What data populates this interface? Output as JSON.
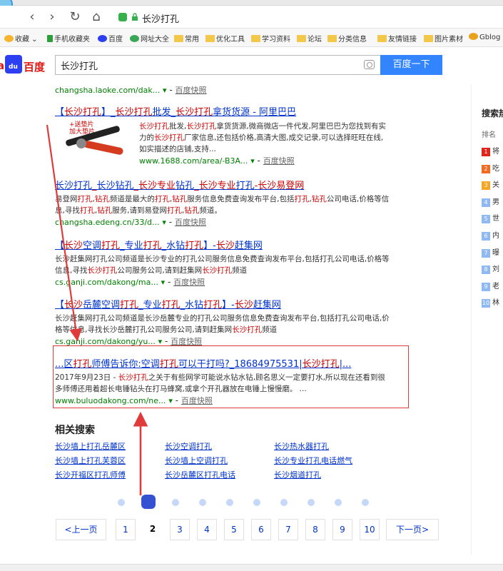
{
  "browser": {
    "address_text": "长沙打孔",
    "back_glyph": "‹",
    "forward_glyph": "›",
    "refresh_glyph": "↻",
    "home_glyph": "⌂"
  },
  "bookmarks": [
    {
      "label": "收藏",
      "icon": "star-icon"
    },
    {
      "label": "手机收藏夹",
      "icon": "phone-icon"
    },
    {
      "label": "百度",
      "icon": "baidu-paw-icon"
    },
    {
      "label": "网址大全",
      "icon": "globe-icon"
    },
    {
      "label": "常用",
      "icon": "folder-icon"
    },
    {
      "label": "优化工具",
      "icon": "folder-icon"
    },
    {
      "label": "学习资料",
      "icon": "folder-icon"
    },
    {
      "label": "论坛",
      "icon": "folder-icon"
    },
    {
      "label": "分类信息",
      "icon": "folder-icon"
    },
    {
      "label": "友情链接",
      "icon": "folder-icon"
    },
    {
      "label": "图片素材",
      "icon": "folder-icon"
    },
    {
      "label": "Gblog",
      "icon": "gblog-icon"
    }
  ],
  "search": {
    "logo_left": "ai",
    "logo_paw": "du",
    "logo_right": "百度",
    "query": "长沙打孔",
    "button_label": "百度一下"
  },
  "top_cut": {
    "url": "changsha.laoke.com/dak...",
    "snapshot": "百度快照"
  },
  "results": [
    {
      "title_parts": [
        "【",
        "长沙打孔",
        "】_",
        "长沙打孔",
        "批发_",
        "长沙打孔",
        "拿货货源 - 阿里巴巴"
      ],
      "thumb_badge": "+送垫片\n加大垫片",
      "desc_parts": [
        "",
        "长沙打孔",
        "批发,",
        "长沙打孔",
        "拿货货源,微商微店一件代发,阿里巴巴为您找到有实力的",
        "长沙打孔",
        "厂家信息,还包括价格,高清大图,成交记录,可以选择旺旺在线,如实描述的店铺,支持..."
      ],
      "url": "www.1688.com/area/-B3A...",
      "snapshot": "百度快照"
    },
    {
      "title_parts": [
        "长沙打孔",
        "_",
        "长沙钻孔",
        "_长沙专业",
        "钻孔",
        "_长沙专业",
        "打孔",
        "-长沙易登网"
      ],
      "desc_parts": [
        "易登网",
        "打孔",
        ",",
        "钻孔",
        "频道是最大的",
        "打孔",
        ",",
        "钻孔",
        "服务信息免费查询发布平台,包括",
        "打孔",
        ",",
        "钻孔",
        "公司电话,价格等信息,寻找",
        "打孔",
        ",",
        "钻孔",
        "服务,请到易登网",
        "打孔",
        ",",
        "钻孔",
        "频道。"
      ],
      "url": "changsha.edeng.cn/33/d...",
      "snapshot": "百度快照"
    },
    {
      "title_parts": [
        "【",
        "长沙",
        "空调",
        "打孔",
        "_专业",
        "打孔",
        "_水钻",
        "打孔",
        "】-",
        "长沙",
        "赶集网"
      ],
      "desc_parts": [
        "长沙赶集网打孔公司频道是长沙专业的打孔公司服务信息免费查询发布平台,包括打孔公司电话,价格等信息,寻找",
        "长沙打孔",
        "公司服务公司,请到赶集网",
        "长沙打孔",
        "频道"
      ],
      "url": "cs.ganji.com/dakong/ma...",
      "snapshot": "百度快照"
    },
    {
      "title_parts": [
        "【",
        "长沙",
        "岳麓空调",
        "打孔",
        "_专业",
        "打孔",
        "_水钻",
        "打孔",
        "】-",
        "长沙",
        "赶集网"
      ],
      "desc_parts": [
        "长沙赶集网打孔公司频道是长沙岳麓专业的打孔公司服务信息免费查询发布平台,包括打孔公司电话,价格等信息,寻找长沙岳麓打孔公司服务公司,请到赶集网",
        "长沙打孔",
        "频道"
      ],
      "url": "cs.ganji.com/dakong/yu...",
      "snapshot": "百度快照"
    },
    {
      "title_parts": [
        "...区",
        "打孔",
        "师傅告诉你:空调",
        "打孔",
        "可以干打吗?_18684975531|",
        "长沙打孔",
        "|..."
      ],
      "desc_parts": [
        "2017年9月23日 - ",
        "长沙打孔",
        "之关于有些网学可能说水钻水钻,顾名思义一定要打水,所以现在还看到很多师傅还用着超长电锤钻头在打马蜂窝,或拿个开孔器放在电锤上慢慢磨。 ..."
      ],
      "url": "www.buluodakong.com/ne...",
      "snapshot": "百度快照"
    }
  ],
  "sidebar": {
    "title": "搜索热",
    "subtitle": "排名",
    "ranks": [
      {
        "n": "1",
        "text": "将",
        "color": "#e2231a"
      },
      {
        "n": "2",
        "text": "吃",
        "color": "#f46a1e"
      },
      {
        "n": "3",
        "text": "关",
        "color": "#f5a623"
      },
      {
        "n": "4",
        "text": "男",
        "color": "#8eb9f5"
      },
      {
        "n": "5",
        "text": "世",
        "color": "#8eb9f5"
      },
      {
        "n": "6",
        "text": "内",
        "color": "#8eb9f5"
      },
      {
        "n": "7",
        "text": "曝",
        "color": "#8eb9f5"
      },
      {
        "n": "8",
        "text": "刘",
        "color": "#8eb9f5"
      },
      {
        "n": "9",
        "text": "老",
        "color": "#8eb9f5"
      },
      {
        "n": "10",
        "text": "林",
        "color": "#8eb9f5"
      }
    ]
  },
  "related": {
    "title": "相关搜索",
    "links": [
      "长沙墙上打孔岳麓区",
      "长沙空调打孔",
      "长沙热水器打孔",
      "长沙墙上打孔芙蓉区",
      "长沙墙上空调打孔",
      "长沙专业打孔电话燃气",
      "长沙开福区打孔师傅",
      "长沙岳麓区打孔电话",
      "长沙烟道打孔"
    ]
  },
  "pager": {
    "prev": "<上一页",
    "pages": [
      "1",
      "2",
      "3",
      "4",
      "5",
      "6",
      "7",
      "8",
      "9",
      "10"
    ],
    "current": "2",
    "next": "下一页>"
  },
  "colors": {
    "accent": "#3385ff",
    "link": "#0033cc",
    "emphasis": "#cc0000",
    "url_green": "#008000",
    "annotation_red": "#e03b3b"
  }
}
